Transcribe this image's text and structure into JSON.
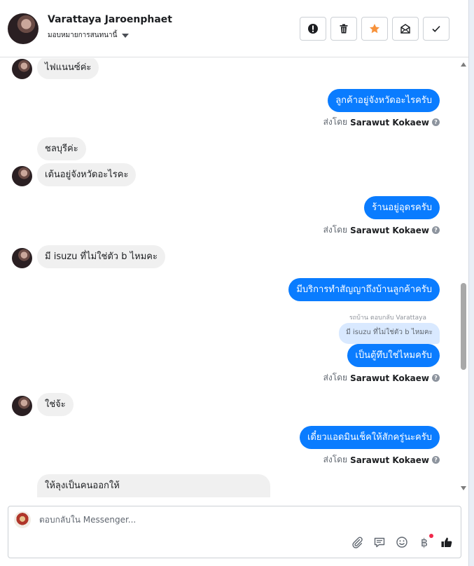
{
  "header": {
    "contact_name": "Varattaya Jaroenphaet",
    "assign_label": "มอบหมายการสนทนานี้",
    "buttons": [
      "spam",
      "delete",
      "star",
      "mark-unread",
      "done"
    ]
  },
  "messages": [
    {
      "dir": "in",
      "text": "ไฟแนนซ์ค่ะ"
    },
    {
      "dir": "out",
      "text": "ลูกค้าอยู่จังหวัดอะไรครับ",
      "sent_by_prefix": "ส่งโดย",
      "sent_by": "Sarawut Kokaew"
    },
    {
      "dir": "in",
      "text": "ชลบุรีค่ะ"
    },
    {
      "dir": "in",
      "text": "เต้นอยู่จังหวัดอะไรคะ"
    },
    {
      "dir": "out",
      "text": "ร้านอยู่อุดรครับ",
      "sent_by_prefix": "ส่งโดย",
      "sent_by": "Sarawut Kokaew"
    },
    {
      "dir": "in",
      "text": "มี isuzu ที่ไม่ใช่ตัว b ไหมคะ"
    },
    {
      "dir": "out",
      "text": "มีบริการทำสัญญาถึงบ้านลูกค้าครับ"
    },
    {
      "dir": "out",
      "reply_label": "รถบ้าน ตอบกลับ Varattaya",
      "quote": "มี isuzu ที่ไม่ใช่ตัว b ไหมคะ",
      "text": "เป็นตู้ทึบใช่ไหมครับ",
      "sent_by_prefix": "ส่งโดย",
      "sent_by": "Sarawut Kokaew"
    },
    {
      "dir": "in",
      "text": "ใช่จ้ะ"
    },
    {
      "dir": "out",
      "text": "เดี๋ยวแอดมินเช็คให้สักครู่นะครับ",
      "sent_by_prefix": "ส่งโดย",
      "sent_by": "Sarawut Kokaew"
    },
    {
      "dir": "in",
      "text": "ให้ลุงเป็นคนออกให้"
    }
  ],
  "composer": {
    "placeholder": "ตอบกลับใน Messenger...",
    "tools": [
      "attach-icon",
      "saved-reply-icon",
      "emoji-icon",
      "baht-icon",
      "like-icon"
    ],
    "baht_symbol": "฿"
  },
  "colors": {
    "outgoing": "#0a7cff",
    "incoming": "#f0f0f0",
    "star": "#f7923b"
  }
}
